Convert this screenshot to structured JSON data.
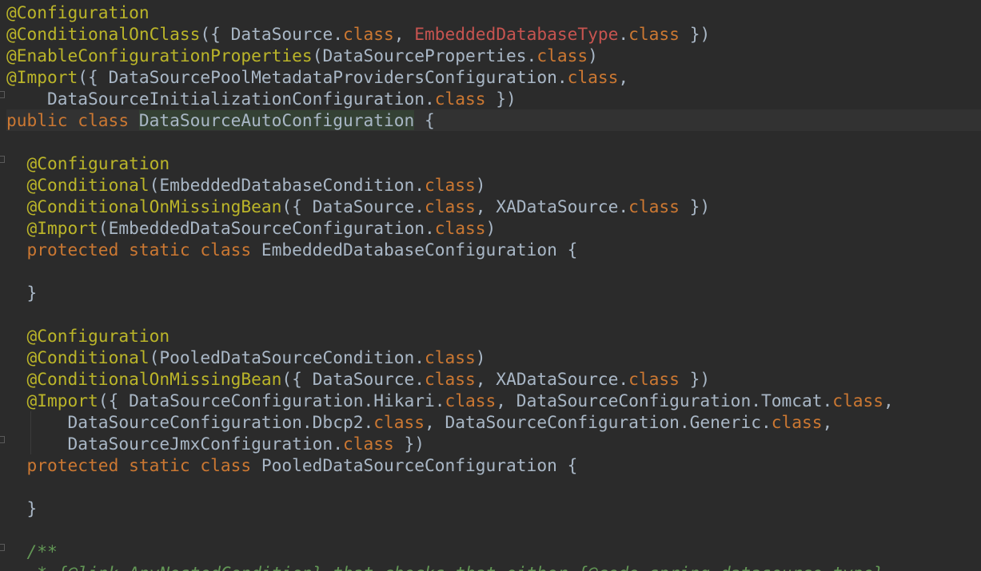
{
  "editor": {
    "language": "Java",
    "colors": {
      "background": "#2b2b2b",
      "caret_row": "#323232",
      "annotation": "#bbb529",
      "keyword": "#cc7832",
      "text": "#a9b7c6",
      "deprecated": "#c75450",
      "comment": "#629755",
      "class_declaration_highlight": "#344134"
    },
    "lines": [
      {
        "tokens": [
          {
            "type": "annotation",
            "text": "@Configuration"
          }
        ]
      },
      {
        "tokens": [
          {
            "type": "annotation",
            "text": "@ConditionalOnClass"
          },
          {
            "type": "text",
            "text": "({ DataSource."
          },
          {
            "type": "keyword",
            "text": "class"
          },
          {
            "type": "text",
            "text": ", "
          },
          {
            "type": "deprecated",
            "text": "EmbeddedDatabaseType"
          },
          {
            "type": "text",
            "text": "."
          },
          {
            "type": "keyword",
            "text": "class"
          },
          {
            "type": "text",
            "text": " })"
          }
        ]
      },
      {
        "tokens": [
          {
            "type": "annotation",
            "text": "@EnableConfigurationProperties"
          },
          {
            "type": "text",
            "text": "(DataSourceProperties."
          },
          {
            "type": "keyword",
            "text": "class"
          },
          {
            "type": "text",
            "text": ")"
          }
        ]
      },
      {
        "tokens": [
          {
            "type": "annotation",
            "text": "@Import"
          },
          {
            "type": "text",
            "text": "({ DataSourcePoolMetadataProvidersConfiguration."
          },
          {
            "type": "keyword",
            "text": "class"
          },
          {
            "type": "text",
            "text": ","
          }
        ]
      },
      {
        "tokens": [
          {
            "type": "text",
            "text": "    DataSourceInitializationConfiguration."
          },
          {
            "type": "keyword",
            "text": "class"
          },
          {
            "type": "text",
            "text": " })"
          }
        ]
      },
      {
        "caret": true,
        "tokens": [
          {
            "type": "keyword",
            "text": "public class "
          },
          {
            "type": "classdecl",
            "text": "DataSourceAutoConfiguration"
          },
          {
            "type": "text",
            "text": " {"
          }
        ]
      },
      {
        "tokens": []
      },
      {
        "tokens": [
          {
            "type": "text",
            "text": "  "
          },
          {
            "type": "annotation",
            "text": "@Configuration"
          }
        ]
      },
      {
        "tokens": [
          {
            "type": "text",
            "text": "  "
          },
          {
            "type": "annotation",
            "text": "@Conditional"
          },
          {
            "type": "text",
            "text": "(EmbeddedDatabaseCondition."
          },
          {
            "type": "keyword",
            "text": "class"
          },
          {
            "type": "text",
            "text": ")"
          }
        ]
      },
      {
        "tokens": [
          {
            "type": "text",
            "text": "  "
          },
          {
            "type": "annotation",
            "text": "@ConditionalOnMissingBean"
          },
          {
            "type": "text",
            "text": "({ DataSource."
          },
          {
            "type": "keyword",
            "text": "class"
          },
          {
            "type": "text",
            "text": ", XADataSource."
          },
          {
            "type": "keyword",
            "text": "class"
          },
          {
            "type": "text",
            "text": " })"
          }
        ]
      },
      {
        "tokens": [
          {
            "type": "text",
            "text": "  "
          },
          {
            "type": "annotation",
            "text": "@Import"
          },
          {
            "type": "text",
            "text": "(EmbeddedDataSourceConfiguration."
          },
          {
            "type": "keyword",
            "text": "class"
          },
          {
            "type": "text",
            "text": ")"
          }
        ]
      },
      {
        "tokens": [
          {
            "type": "text",
            "text": "  "
          },
          {
            "type": "keyword",
            "text": "protected static class "
          },
          {
            "type": "text",
            "text": "EmbeddedDatabaseConfiguration {"
          }
        ]
      },
      {
        "tokens": []
      },
      {
        "tokens": [
          {
            "type": "text",
            "text": "  }"
          }
        ]
      },
      {
        "tokens": []
      },
      {
        "tokens": [
          {
            "type": "text",
            "text": "  "
          },
          {
            "type": "annotation",
            "text": "@Configuration"
          }
        ]
      },
      {
        "tokens": [
          {
            "type": "text",
            "text": "  "
          },
          {
            "type": "annotation",
            "text": "@Conditional"
          },
          {
            "type": "text",
            "text": "(PooledDataSourceCondition."
          },
          {
            "type": "keyword",
            "text": "class"
          },
          {
            "type": "text",
            "text": ")"
          }
        ]
      },
      {
        "tokens": [
          {
            "type": "text",
            "text": "  "
          },
          {
            "type": "annotation",
            "text": "@ConditionalOnMissingBean"
          },
          {
            "type": "text",
            "text": "({ DataSource."
          },
          {
            "type": "keyword",
            "text": "class"
          },
          {
            "type": "text",
            "text": ", XADataSource."
          },
          {
            "type": "keyword",
            "text": "class"
          },
          {
            "type": "text",
            "text": " })"
          }
        ]
      },
      {
        "tokens": [
          {
            "type": "text",
            "text": "  "
          },
          {
            "type": "annotation",
            "text": "@Import"
          },
          {
            "type": "text",
            "text": "({ DataSourceConfiguration.Hikari."
          },
          {
            "type": "keyword",
            "text": "class"
          },
          {
            "type": "text",
            "text": ", DataSourceConfiguration.Tomcat."
          },
          {
            "type": "keyword",
            "text": "class"
          },
          {
            "type": "text",
            "text": ","
          }
        ]
      },
      {
        "tokens": [
          {
            "type": "text",
            "text": "      DataSourceConfiguration.Dbcp2."
          },
          {
            "type": "keyword",
            "text": "class"
          },
          {
            "type": "text",
            "text": ", DataSourceConfiguration.Generic."
          },
          {
            "type": "keyword",
            "text": "class"
          },
          {
            "type": "text",
            "text": ","
          }
        ]
      },
      {
        "tokens": [
          {
            "type": "text",
            "text": "      DataSourceJmxConfiguration."
          },
          {
            "type": "keyword",
            "text": "class"
          },
          {
            "type": "text",
            "text": " })"
          }
        ]
      },
      {
        "tokens": [
          {
            "type": "text",
            "text": "  "
          },
          {
            "type": "keyword",
            "text": "protected static class "
          },
          {
            "type": "text",
            "text": "PooledDataSourceConfiguration {"
          }
        ]
      },
      {
        "tokens": []
      },
      {
        "tokens": [
          {
            "type": "text",
            "text": "  }"
          }
        ]
      },
      {
        "tokens": []
      },
      {
        "tokens": [
          {
            "type": "text",
            "text": "  "
          },
          {
            "type": "comment",
            "text": "/**"
          }
        ]
      },
      {
        "tokens": [
          {
            "type": "comment",
            "text": "   * {@link AnyNestedCondition} that checks that either {@code spring.datasource.type}"
          }
        ]
      }
    ]
  }
}
